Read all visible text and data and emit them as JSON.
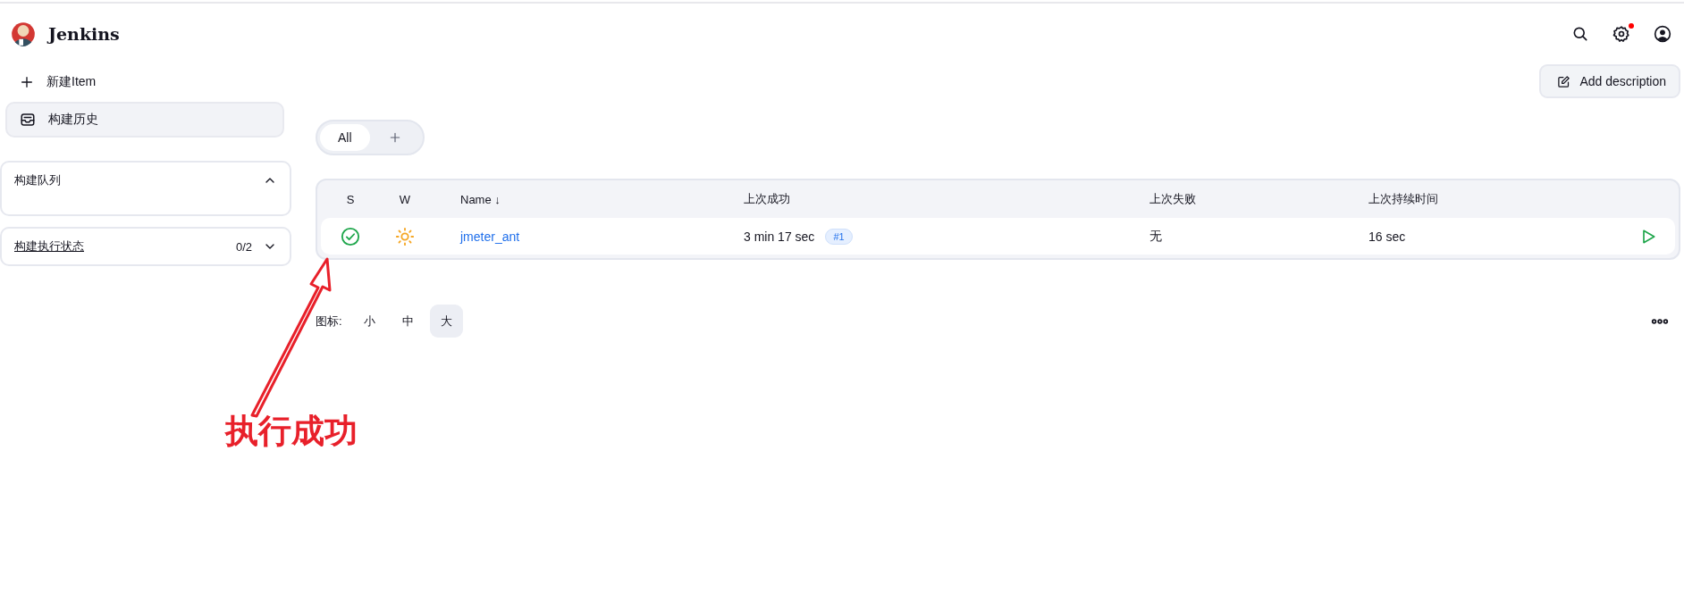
{
  "header": {
    "title": "Jenkins",
    "settings_notification": true
  },
  "sidebar": {
    "tasks": [
      {
        "label": "新建Item",
        "selected": false
      },
      {
        "label": "构建历史",
        "selected": true
      }
    ],
    "panels": [
      {
        "title": "构建队列",
        "link": false,
        "expanded": true
      },
      {
        "title": "构建执行状态",
        "link": true,
        "count": "0/2",
        "expanded": false
      }
    ]
  },
  "main": {
    "add_description": "Add description",
    "view_tabs": [
      {
        "label": "All",
        "selected": true
      }
    ],
    "table": {
      "columns": [
        "S",
        "W",
        "Name ↓",
        "上次成功",
        "上次失败",
        "上次持续时间"
      ],
      "rows": [
        {
          "status": {
            "kind": "success"
          },
          "weather": {
            "kind": "sunny"
          },
          "name": "jmeter_ant",
          "last_success": "3 min 17 sec",
          "last_build": "#1",
          "last_failure": "无",
          "last_duration": "16 sec"
        }
      ]
    },
    "icon_size": {
      "label": "图标:",
      "options": [
        {
          "label": "小",
          "selected": false
        },
        {
          "label": "中",
          "selected": false
        },
        {
          "label": "大",
          "selected": true
        }
      ]
    }
  },
  "annotation": {
    "text": "执行成功"
  }
}
